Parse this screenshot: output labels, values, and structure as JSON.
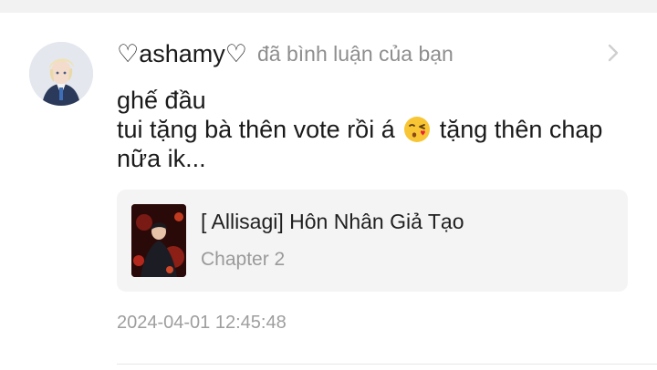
{
  "notification": {
    "username": "♡ashamy♡",
    "action_text": "đã bình luận của bạn",
    "comment_lines": [
      "ghế đầu",
      "tui tặng bà thên vote rồi á",
      "tặng thên chap",
      "nữa ik..."
    ],
    "emoji": "face-blowing-kiss-icon",
    "story": {
      "title": "[ Allisagi] Hôn Nhân Giả Tạo",
      "chapter": "Chapter 2"
    },
    "timestamp": "2024-04-01 12:45:48"
  },
  "colors": {
    "top_bar": "#f2f2f2",
    "card_background": "#f4f4f4",
    "muted_text": "#8e8e8e",
    "primary_text": "#1a1a1a"
  }
}
